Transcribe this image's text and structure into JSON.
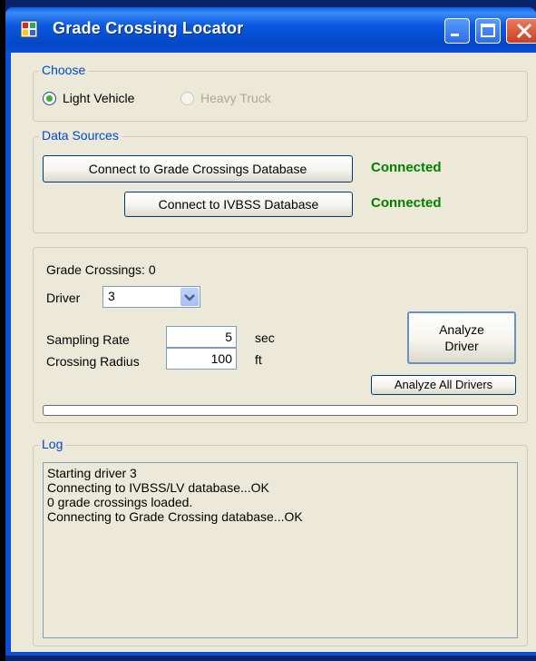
{
  "window": {
    "title": "Grade Crossing Locator"
  },
  "choose": {
    "legend": "Choose",
    "options": [
      {
        "label": "Light Vehicle",
        "selected": true,
        "enabled": true
      },
      {
        "label": "Heavy Truck",
        "selected": false,
        "enabled": false
      }
    ]
  },
  "data_sources": {
    "legend": "Data Sources",
    "grade_btn": "Connect to Grade Crossings Database",
    "grade_status": "Connected",
    "ivbss_btn": "Connect to IVBSS Database",
    "ivbss_status": "Connected"
  },
  "analysis": {
    "grade_crossings_label": "Grade Crossings: 0",
    "driver_label": "Driver",
    "driver_value": "3",
    "sampling_label": "Sampling Rate",
    "sampling_value": "5",
    "sampling_unit": "sec",
    "radius_label": "Crossing Radius",
    "radius_value": "100",
    "radius_unit": "ft",
    "analyze_driver_btn_line1": "Analyze",
    "analyze_driver_btn_line2": "Driver",
    "analyze_all_btn": "Analyze All Drivers",
    "progress": 0
  },
  "log": {
    "legend": "Log",
    "lines": [
      "Starting driver 3",
      "Connecting to IVBSS/LV database...OK",
      "0 grade crossings loaded.",
      "Connecting to Grade Crossing database...OK"
    ]
  },
  "colors": {
    "accent": "#0046d5",
    "status": "#008000",
    "titlebar": "#0a58e0"
  }
}
